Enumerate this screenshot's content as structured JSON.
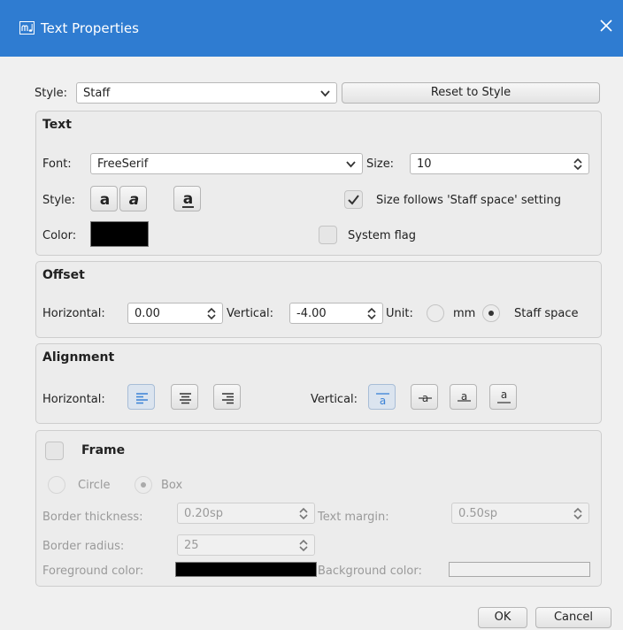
{
  "window": {
    "title": "Text Properties",
    "app_icon": "musescore-icon",
    "close_icon": "close-icon"
  },
  "style_row": {
    "label": "Style:",
    "value": "Staff",
    "reset_button": "Reset to Style"
  },
  "text_group": {
    "title": "Text",
    "font_label": "Font:",
    "font_value": "FreeSerif",
    "size_label": "Size:",
    "size_value": "10",
    "style_label": "Style:",
    "style_buttons": [
      "bold-icon",
      "italic-icon",
      "underline-icon"
    ],
    "size_follows": {
      "label": "Size follows 'Staff space' setting",
      "checked": true
    },
    "color_label": "Color:",
    "color_value": "#000000",
    "system_flag": {
      "label": "System flag",
      "checked": false
    }
  },
  "offset_group": {
    "title": "Offset",
    "horizontal_label": "Horizontal:",
    "horizontal_value": "0.00",
    "vertical_label": "Vertical:",
    "vertical_value": "-4.00",
    "unit_label": "Unit:",
    "unit_options": [
      "mm",
      "Staff space"
    ],
    "unit_selected": "Staff space"
  },
  "alignment_group": {
    "title": "Alignment",
    "horizontal_label": "Horizontal:",
    "horizontal_buttons": [
      "align-left-icon",
      "align-center-icon",
      "align-right-icon"
    ],
    "horizontal_selected": "align-left-icon",
    "vertical_label": "Vertical:",
    "vertical_buttons": [
      "align-top-icon",
      "align-vcenter-icon",
      "align-baseline-icon",
      "align-bottom-icon"
    ],
    "vertical_selected": "align-top-icon"
  },
  "frame_group": {
    "title": "Frame",
    "enabled": false,
    "shape_options": [
      "Circle",
      "Box"
    ],
    "shape_selected": "Box",
    "border_thickness_label": "Border thickness:",
    "border_thickness_value": "0.20sp",
    "text_margin_label": "Text margin:",
    "text_margin_value": "0.50sp",
    "border_radius_label": "Border radius:",
    "border_radius_value": "25",
    "foreground_label": "Foreground color:",
    "foreground_color": "#000000",
    "background_label": "Background color:",
    "background_color": "#f0f0f0"
  },
  "footer": {
    "ok": "OK",
    "cancel": "Cancel"
  },
  "colors": {
    "titlebar": "#2f7cd1",
    "accent": "#3b82d6"
  }
}
